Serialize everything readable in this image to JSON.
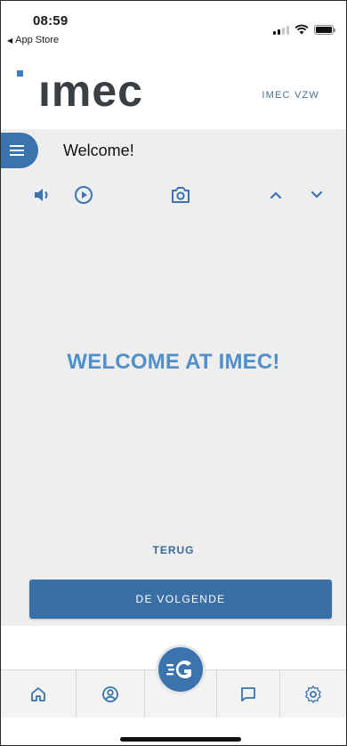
{
  "status_bar": {
    "time": "08:59",
    "back_app": "App Store"
  },
  "header": {
    "logo": "ımec",
    "company": "IMEC VZW"
  },
  "titlebar": {
    "title": "Welcome!"
  },
  "controls": {
    "icons": [
      "speaker-icon",
      "play-icon",
      "camera-icon",
      "chevron-up-icon",
      "chevron-down-icon"
    ]
  },
  "content": {
    "heading": "WELCOME AT IMEC!",
    "back_label": "TERUG",
    "next_label": "DE VOLGENDE"
  },
  "bottom_nav": {
    "items": [
      "home-icon",
      "profile-icon",
      "brand-icon",
      "chat-icon",
      "settings-icon"
    ]
  },
  "colors": {
    "accent": "#3a73ad",
    "heading": "#4f8fca",
    "background": "#eeeeee"
  }
}
